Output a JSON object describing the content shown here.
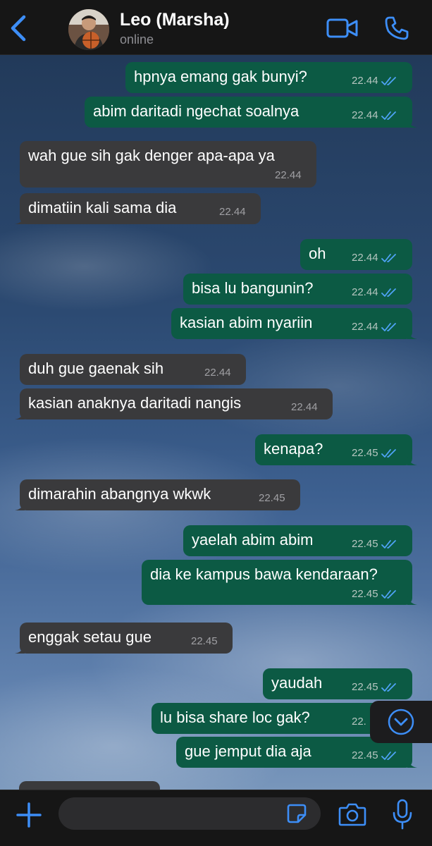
{
  "header": {
    "back_label": "back",
    "contact_name": "Leo (Marsha)",
    "status": "online",
    "icons": [
      "chevron-left-icon",
      "video-call-icon",
      "phone-call-icon"
    ]
  },
  "messages": [
    {
      "dir": "out",
      "text": "hpnya emang gak bunyi?",
      "time": "22.44"
    },
    {
      "dir": "out",
      "text": "abim daritadi ngechat soalnya",
      "time": "22.44"
    },
    {
      "dir": "in",
      "text": "wah gue sih gak denger apa-apa ya",
      "time": "22.44"
    },
    {
      "dir": "in",
      "text": "dimatiin kali sama dia",
      "time": "22.44"
    },
    {
      "dir": "out",
      "text": "oh",
      "time": "22.44"
    },
    {
      "dir": "out",
      "text": "bisa lu bangunin?",
      "time": "22.44"
    },
    {
      "dir": "out",
      "text": "kasian abim nyariin",
      "time": "22.44"
    },
    {
      "dir": "in",
      "text": "duh gue gaenak sih",
      "time": "22.44"
    },
    {
      "dir": "in",
      "text": "kasian anaknya daritadi nangis",
      "time": "22.44"
    },
    {
      "dir": "out",
      "text": "kenapa?",
      "time": "22.45"
    },
    {
      "dir": "in",
      "text": "dimarahin abangnya wkwk",
      "time": "22.45"
    },
    {
      "dir": "out",
      "text": "yaelah abim abim",
      "time": "22.45"
    },
    {
      "dir": "out",
      "text": "dia ke kampus bawa kendaraan?",
      "time": "22.45"
    },
    {
      "dir": "in",
      "text": "enggak setau gue",
      "time": "22.45"
    },
    {
      "dir": "out",
      "text": "yaudah",
      "time": "22.45"
    },
    {
      "dir": "out",
      "text": "lu bisa share loc gak?",
      "time": "22."
    },
    {
      "dir": "out",
      "text": "gue jemput dia aja",
      "time": "22.45"
    }
  ],
  "status": {
    "read": "read-receipt-double-tick-icon"
  },
  "colors": {
    "accent": "#3d8ef7",
    "outgoing_bubble": "#0c5a44",
    "incoming_bubble": "#3a3a3c",
    "read_tick": "#4fa3f7"
  },
  "inputbar": {
    "icons": [
      "plus-icon",
      "sticker-icon",
      "camera-icon",
      "microphone-icon"
    ],
    "message_placeholder": ""
  }
}
